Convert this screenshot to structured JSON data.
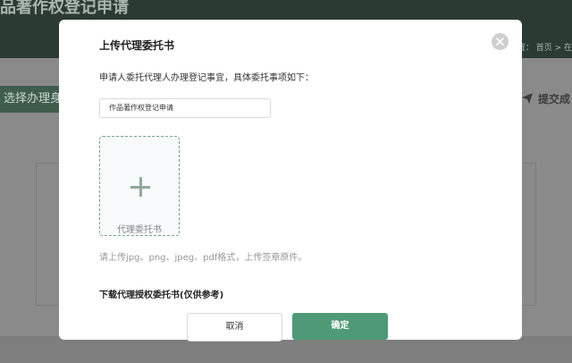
{
  "background": {
    "header_title": "品著作权登记申请",
    "breadcrumb": "置：  首页  >  在",
    "step_left": "选择办理身",
    "step_right": "提交成"
  },
  "modal": {
    "title": "上传代理委托书",
    "description": "申请人委托代理人办理登记事宜，具体委托事项如下：",
    "matter_value": "作品著作权登记申请",
    "upload_label": "代理委托书",
    "hint": "请上传jpg、png、jpeg、pdf格式，上传签章原件。",
    "download_link": "下载代理授权委托书(仅供参考)",
    "cancel_label": "取消",
    "ok_label": "确定"
  },
  "colors": {
    "primary": "#4e9a76",
    "header_bg": "#2b3a33"
  }
}
